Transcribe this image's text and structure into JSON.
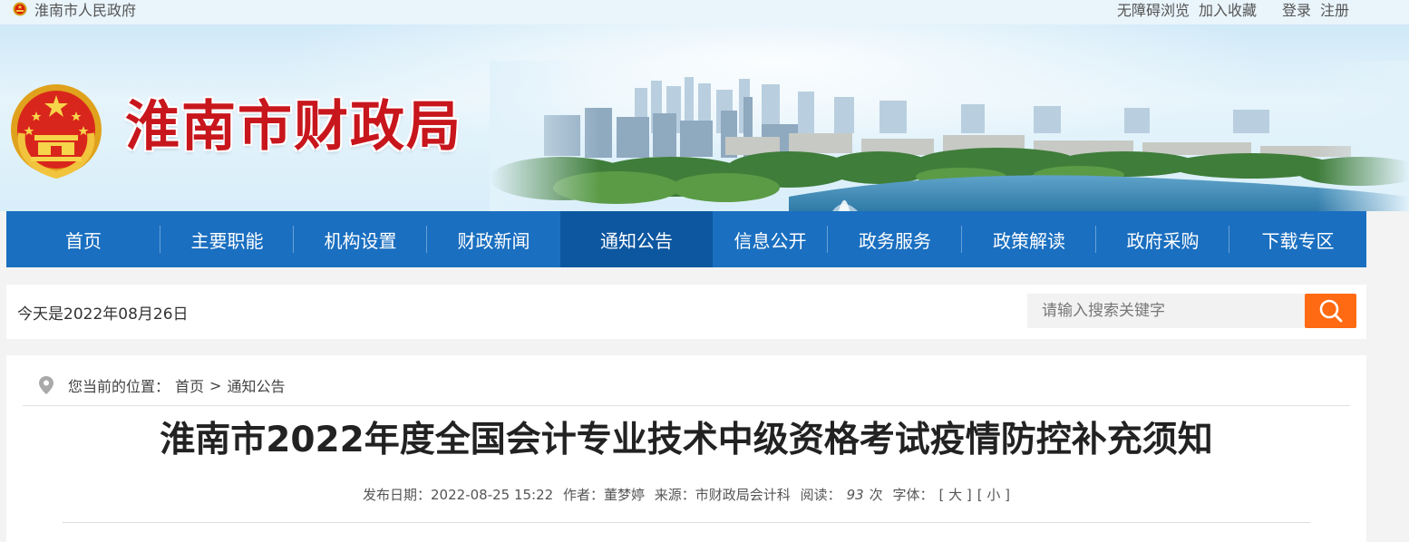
{
  "topbar": {
    "gov_link": "淮南市人民政府",
    "links": [
      "无障碍浏览",
      "加入收藏",
      "登录",
      "注册"
    ]
  },
  "banner": {
    "site_title": "淮南市财政局"
  },
  "nav": {
    "items": [
      "首页",
      "主要职能",
      "机构设置",
      "财政新闻",
      "通知公告",
      "信息公开",
      "政务服务",
      "政策解读",
      "政府采购",
      "下载专区"
    ],
    "active_index": 4
  },
  "infobar": {
    "date_text": "今天是2022年08月26日",
    "search_placeholder": "请输入搜索关键字"
  },
  "breadcrumb": {
    "label": "您当前的位置：",
    "home": "首页",
    "separator": ">",
    "current": "通知公告"
  },
  "article": {
    "title": "淮南市2022年度全国会计专业技术中级资格考试疫情防控补充须知",
    "meta": {
      "publish": "发布日期：2022-08-25 15:22",
      "author": "作者：董梦婷",
      "source": "来源：市财政局会计科",
      "views_label": "阅读：",
      "views": "93",
      "views_unit": "次",
      "font_label": "字体：",
      "font_large": "[ 大 ]",
      "font_small": "[ 小 ]"
    }
  },
  "colors": {
    "nav_bg": "#1a6fc0",
    "nav_active": "#0d57a0",
    "title_red": "#c8161d",
    "search_btn": "#ff6a12"
  }
}
